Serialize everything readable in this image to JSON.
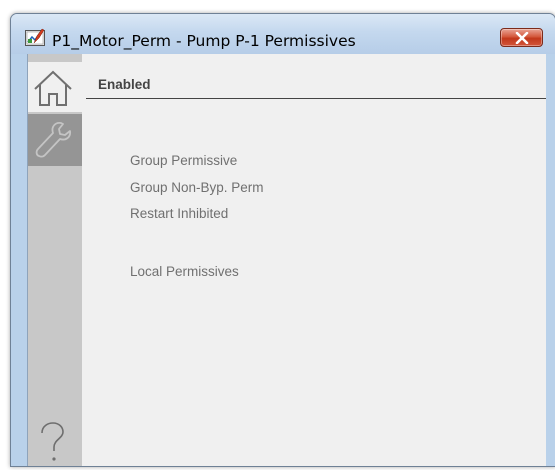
{
  "window": {
    "title": "P1_Motor_Perm - Pump P-1 Permissives",
    "icons": {
      "app": "faceplate-app-icon",
      "close": "close-icon"
    },
    "colors": {
      "close_button": "#c74a30",
      "content_background": "#f0f0f0",
      "sidebar": "#c8c8c8"
    }
  },
  "sidebar": {
    "tabs": [
      {
        "name": "home",
        "icon": "home-icon",
        "selected": true
      },
      {
        "name": "maintenance",
        "icon": "wrench-icon",
        "selected": false
      }
    ],
    "help_icon": "question-mark-icon"
  },
  "content": {
    "status": "Enabled",
    "permissives": [
      "Group Permissive",
      "Group Non-Byp. Perm",
      "Restart Inhibited"
    ],
    "local_permissives_label": "Local Permissives"
  }
}
